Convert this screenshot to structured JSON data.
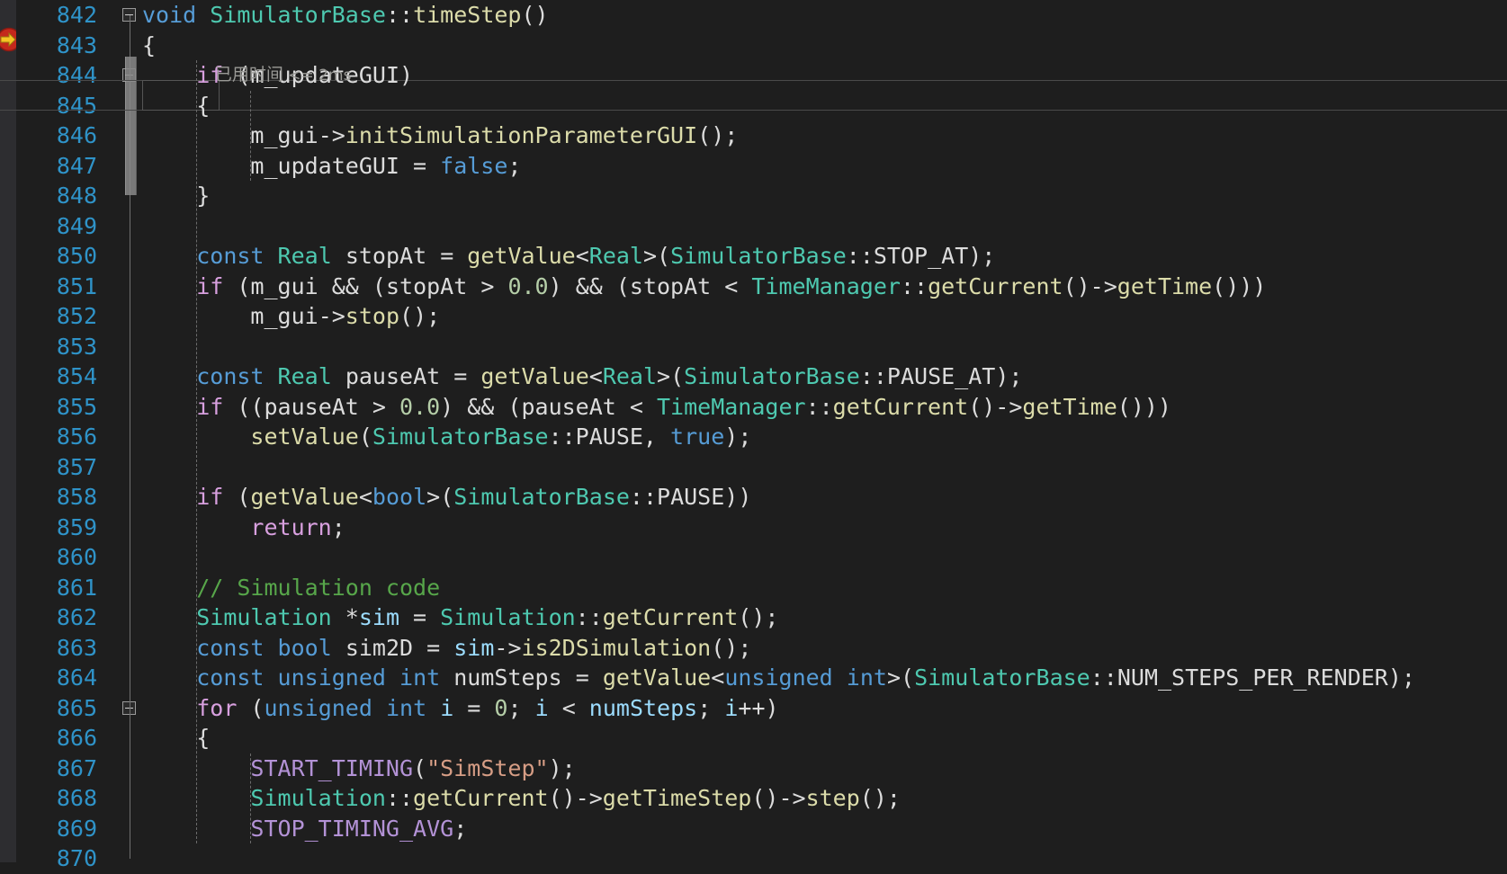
{
  "editor": {
    "language": "cpp",
    "first_line_number": 842,
    "line_height_px": 33.5,
    "colors": {
      "background": "#1e1e1e",
      "gutter_strip": "#2d2d30",
      "line_number": "#2f93c8",
      "keyword": "#569cd6",
      "control_keyword": "#d8a0df",
      "type": "#4ec9b0",
      "function": "#dcdcaa",
      "string": "#d69d85",
      "macro": "#b392d6",
      "comment": "#57a64a",
      "number": "#b5cea8",
      "identifier": "#9cdcfe",
      "plain": "#dcdcdc",
      "codelens": "#9a9a96",
      "marker_circle": "#c4281c",
      "marker_arrow": "#f6c324"
    },
    "markers": {
      "execution_pointer": "breakpoint-with-arrow-icon"
    },
    "codelens": {
      "line": 843,
      "cjk_text": "已用时间",
      "latin_text": " <= 2ms"
    },
    "current_line": 845,
    "lines": [
      {
        "n": 842,
        "fold": "minus",
        "tokens": [
          {
            "t": "void",
            "c": "kw"
          },
          {
            "t": " ",
            "c": "pl"
          },
          {
            "t": "SimulatorBase",
            "c": "type"
          },
          {
            "t": "::",
            "c": "pl"
          },
          {
            "t": "timeStep",
            "c": "fn"
          },
          {
            "t": "()",
            "c": "pl"
          }
        ]
      },
      {
        "n": 843,
        "fold": "",
        "tokens": [
          {
            "t": "{",
            "c": "pl"
          }
        ]
      },
      {
        "n": 844,
        "fold": "minus",
        "tokens": [
          {
            "t": "    ",
            "c": "pl"
          },
          {
            "t": "if",
            "c": "ctl"
          },
          {
            "t": " (",
            "c": "pl"
          },
          {
            "t": "m_updateGUI",
            "c": "pl"
          },
          {
            "t": ")",
            "c": "pl"
          }
        ]
      },
      {
        "n": 845,
        "fold": "",
        "tokens": [
          {
            "t": "    {",
            "c": "pl"
          }
        ]
      },
      {
        "n": 846,
        "fold": "",
        "tokens": [
          {
            "t": "        ",
            "c": "pl"
          },
          {
            "t": "m_gui",
            "c": "pl"
          },
          {
            "t": "->",
            "c": "pl"
          },
          {
            "t": "initSimulationParameterGUI",
            "c": "fn"
          },
          {
            "t": "();",
            "c": "pl"
          }
        ]
      },
      {
        "n": 847,
        "fold": "",
        "tokens": [
          {
            "t": "        ",
            "c": "pl"
          },
          {
            "t": "m_updateGUI",
            "c": "pl"
          },
          {
            "t": " = ",
            "c": "pl"
          },
          {
            "t": "false",
            "c": "kw"
          },
          {
            "t": ";",
            "c": "pl"
          }
        ]
      },
      {
        "n": 848,
        "fold": "",
        "tokens": [
          {
            "t": "    }",
            "c": "pl"
          }
        ]
      },
      {
        "n": 849,
        "fold": "",
        "tokens": []
      },
      {
        "n": 850,
        "fold": "",
        "tokens": [
          {
            "t": "    ",
            "c": "pl"
          },
          {
            "t": "const",
            "c": "kw"
          },
          {
            "t": " ",
            "c": "pl"
          },
          {
            "t": "Real",
            "c": "type"
          },
          {
            "t": " ",
            "c": "pl"
          },
          {
            "t": "stopAt",
            "c": "pl"
          },
          {
            "t": " = ",
            "c": "pl"
          },
          {
            "t": "getValue",
            "c": "fn"
          },
          {
            "t": "<",
            "c": "pl"
          },
          {
            "t": "Real",
            "c": "type"
          },
          {
            "t": ">(",
            "c": "pl"
          },
          {
            "t": "SimulatorBase",
            "c": "type"
          },
          {
            "t": "::STOP_AT);",
            "c": "pl"
          }
        ]
      },
      {
        "n": 851,
        "fold": "",
        "tokens": [
          {
            "t": "    ",
            "c": "pl"
          },
          {
            "t": "if",
            "c": "ctl"
          },
          {
            "t": " (",
            "c": "pl"
          },
          {
            "t": "m_gui",
            "c": "pl"
          },
          {
            "t": " && (",
            "c": "pl"
          },
          {
            "t": "stopAt",
            "c": "pl"
          },
          {
            "t": " > ",
            "c": "pl"
          },
          {
            "t": "0.0",
            "c": "num"
          },
          {
            "t": ") && (",
            "c": "pl"
          },
          {
            "t": "stopAt",
            "c": "pl"
          },
          {
            "t": " < ",
            "c": "pl"
          },
          {
            "t": "TimeManager",
            "c": "type"
          },
          {
            "t": "::",
            "c": "pl"
          },
          {
            "t": "getCurrent",
            "c": "fn"
          },
          {
            "t": "()->",
            "c": "pl"
          },
          {
            "t": "getTime",
            "c": "fn"
          },
          {
            "t": "()))",
            "c": "pl"
          }
        ]
      },
      {
        "n": 852,
        "fold": "",
        "tokens": [
          {
            "t": "        ",
            "c": "pl"
          },
          {
            "t": "m_gui",
            "c": "pl"
          },
          {
            "t": "->",
            "c": "pl"
          },
          {
            "t": "stop",
            "c": "fn"
          },
          {
            "t": "();",
            "c": "pl"
          }
        ]
      },
      {
        "n": 853,
        "fold": "",
        "tokens": []
      },
      {
        "n": 854,
        "fold": "",
        "tokens": [
          {
            "t": "    ",
            "c": "pl"
          },
          {
            "t": "const",
            "c": "kw"
          },
          {
            "t": " ",
            "c": "pl"
          },
          {
            "t": "Real",
            "c": "type"
          },
          {
            "t": " ",
            "c": "pl"
          },
          {
            "t": "pauseAt",
            "c": "pl"
          },
          {
            "t": " = ",
            "c": "pl"
          },
          {
            "t": "getValue",
            "c": "fn"
          },
          {
            "t": "<",
            "c": "pl"
          },
          {
            "t": "Real",
            "c": "type"
          },
          {
            "t": ">(",
            "c": "pl"
          },
          {
            "t": "SimulatorBase",
            "c": "type"
          },
          {
            "t": "::PAUSE_AT);",
            "c": "pl"
          }
        ]
      },
      {
        "n": 855,
        "fold": "",
        "tokens": [
          {
            "t": "    ",
            "c": "pl"
          },
          {
            "t": "if",
            "c": "ctl"
          },
          {
            "t": " ((",
            "c": "pl"
          },
          {
            "t": "pauseAt",
            "c": "pl"
          },
          {
            "t": " > ",
            "c": "pl"
          },
          {
            "t": "0.0",
            "c": "num"
          },
          {
            "t": ") && (",
            "c": "pl"
          },
          {
            "t": "pauseAt",
            "c": "pl"
          },
          {
            "t": " < ",
            "c": "pl"
          },
          {
            "t": "TimeManager",
            "c": "type"
          },
          {
            "t": "::",
            "c": "pl"
          },
          {
            "t": "getCurrent",
            "c": "fn"
          },
          {
            "t": "()->",
            "c": "pl"
          },
          {
            "t": "getTime",
            "c": "fn"
          },
          {
            "t": "()))",
            "c": "pl"
          }
        ]
      },
      {
        "n": 856,
        "fold": "",
        "tokens": [
          {
            "t": "        ",
            "c": "pl"
          },
          {
            "t": "setValue",
            "c": "fn"
          },
          {
            "t": "(",
            "c": "pl"
          },
          {
            "t": "SimulatorBase",
            "c": "type"
          },
          {
            "t": "::PAUSE, ",
            "c": "pl"
          },
          {
            "t": "true",
            "c": "kw"
          },
          {
            "t": ");",
            "c": "pl"
          }
        ]
      },
      {
        "n": 857,
        "fold": "",
        "tokens": []
      },
      {
        "n": 858,
        "fold": "",
        "tokens": [
          {
            "t": "    ",
            "c": "pl"
          },
          {
            "t": "if",
            "c": "ctl"
          },
          {
            "t": " (",
            "c": "pl"
          },
          {
            "t": "getValue",
            "c": "fn"
          },
          {
            "t": "<",
            "c": "pl"
          },
          {
            "t": "bool",
            "c": "kw"
          },
          {
            "t": ">(",
            "c": "pl"
          },
          {
            "t": "SimulatorBase",
            "c": "type"
          },
          {
            "t": "::PAUSE))",
            "c": "pl"
          }
        ]
      },
      {
        "n": 859,
        "fold": "",
        "tokens": [
          {
            "t": "        ",
            "c": "pl"
          },
          {
            "t": "return",
            "c": "ctl"
          },
          {
            "t": ";",
            "c": "pl"
          }
        ]
      },
      {
        "n": 860,
        "fold": "",
        "tokens": []
      },
      {
        "n": 861,
        "fold": "",
        "tokens": [
          {
            "t": "    ",
            "c": "pl"
          },
          {
            "t": "// Simulation code",
            "c": "cmt"
          }
        ]
      },
      {
        "n": 862,
        "fold": "",
        "tokens": [
          {
            "t": "    ",
            "c": "pl"
          },
          {
            "t": "Simulation",
            "c": "type"
          },
          {
            "t": " *",
            "c": "pl"
          },
          {
            "t": "sim",
            "c": "id"
          },
          {
            "t": " = ",
            "c": "pl"
          },
          {
            "t": "Simulation",
            "c": "type"
          },
          {
            "t": "::",
            "c": "pl"
          },
          {
            "t": "getCurrent",
            "c": "fn"
          },
          {
            "t": "();",
            "c": "pl"
          }
        ]
      },
      {
        "n": 863,
        "fold": "",
        "tokens": [
          {
            "t": "    ",
            "c": "pl"
          },
          {
            "t": "const",
            "c": "kw"
          },
          {
            "t": " ",
            "c": "pl"
          },
          {
            "t": "bool",
            "c": "kw"
          },
          {
            "t": " ",
            "c": "pl"
          },
          {
            "t": "sim2D",
            "c": "pl"
          },
          {
            "t": " = ",
            "c": "pl"
          },
          {
            "t": "sim",
            "c": "id"
          },
          {
            "t": "->",
            "c": "pl"
          },
          {
            "t": "is2DSimulation",
            "c": "fn"
          },
          {
            "t": "();",
            "c": "pl"
          }
        ]
      },
      {
        "n": 864,
        "fold": "",
        "tokens": [
          {
            "t": "    ",
            "c": "pl"
          },
          {
            "t": "const",
            "c": "kw"
          },
          {
            "t": " ",
            "c": "pl"
          },
          {
            "t": "unsigned",
            "c": "kw"
          },
          {
            "t": " ",
            "c": "pl"
          },
          {
            "t": "int",
            "c": "kw"
          },
          {
            "t": " ",
            "c": "pl"
          },
          {
            "t": "numSteps",
            "c": "pl"
          },
          {
            "t": " = ",
            "c": "pl"
          },
          {
            "t": "getValue",
            "c": "fn"
          },
          {
            "t": "<",
            "c": "pl"
          },
          {
            "t": "unsigned",
            "c": "kw"
          },
          {
            "t": " ",
            "c": "pl"
          },
          {
            "t": "int",
            "c": "kw"
          },
          {
            "t": ">(",
            "c": "pl"
          },
          {
            "t": "SimulatorBase",
            "c": "type"
          },
          {
            "t": "::NUM_STEPS_PER_RENDER);",
            "c": "pl"
          }
        ]
      },
      {
        "n": 865,
        "fold": "minus",
        "tokens": [
          {
            "t": "    ",
            "c": "pl"
          },
          {
            "t": "for",
            "c": "ctl"
          },
          {
            "t": " (",
            "c": "pl"
          },
          {
            "t": "unsigned",
            "c": "kw"
          },
          {
            "t": " ",
            "c": "pl"
          },
          {
            "t": "int",
            "c": "kw"
          },
          {
            "t": " ",
            "c": "pl"
          },
          {
            "t": "i",
            "c": "id"
          },
          {
            "t": " = ",
            "c": "pl"
          },
          {
            "t": "0",
            "c": "num"
          },
          {
            "t": "; ",
            "c": "pl"
          },
          {
            "t": "i",
            "c": "id"
          },
          {
            "t": " < ",
            "c": "pl"
          },
          {
            "t": "numSteps",
            "c": "id"
          },
          {
            "t": "; ",
            "c": "pl"
          },
          {
            "t": "i",
            "c": "id"
          },
          {
            "t": "++)",
            "c": "pl"
          }
        ]
      },
      {
        "n": 866,
        "fold": "",
        "tokens": [
          {
            "t": "    {",
            "c": "pl"
          }
        ]
      },
      {
        "n": 867,
        "fold": "",
        "tokens": [
          {
            "t": "        ",
            "c": "pl"
          },
          {
            "t": "START_TIMING",
            "c": "mac"
          },
          {
            "t": "(",
            "c": "pl"
          },
          {
            "t": "\"SimStep\"",
            "c": "str"
          },
          {
            "t": ");",
            "c": "pl"
          }
        ]
      },
      {
        "n": 868,
        "fold": "",
        "tokens": [
          {
            "t": "        ",
            "c": "pl"
          },
          {
            "t": "Simulation",
            "c": "type"
          },
          {
            "t": "::",
            "c": "pl"
          },
          {
            "t": "getCurrent",
            "c": "fn"
          },
          {
            "t": "()->",
            "c": "pl"
          },
          {
            "t": "getTimeStep",
            "c": "fn"
          },
          {
            "t": "()->",
            "c": "pl"
          },
          {
            "t": "step",
            "c": "fn"
          },
          {
            "t": "();",
            "c": "pl"
          }
        ]
      },
      {
        "n": 869,
        "fold": "",
        "tokens": [
          {
            "t": "        ",
            "c": "pl"
          },
          {
            "t": "STOP_TIMING_AVG",
            "c": "mac"
          },
          {
            "t": ";",
            "c": "pl"
          }
        ]
      },
      {
        "n": 870,
        "fold": "",
        "tokens": []
      }
    ]
  }
}
